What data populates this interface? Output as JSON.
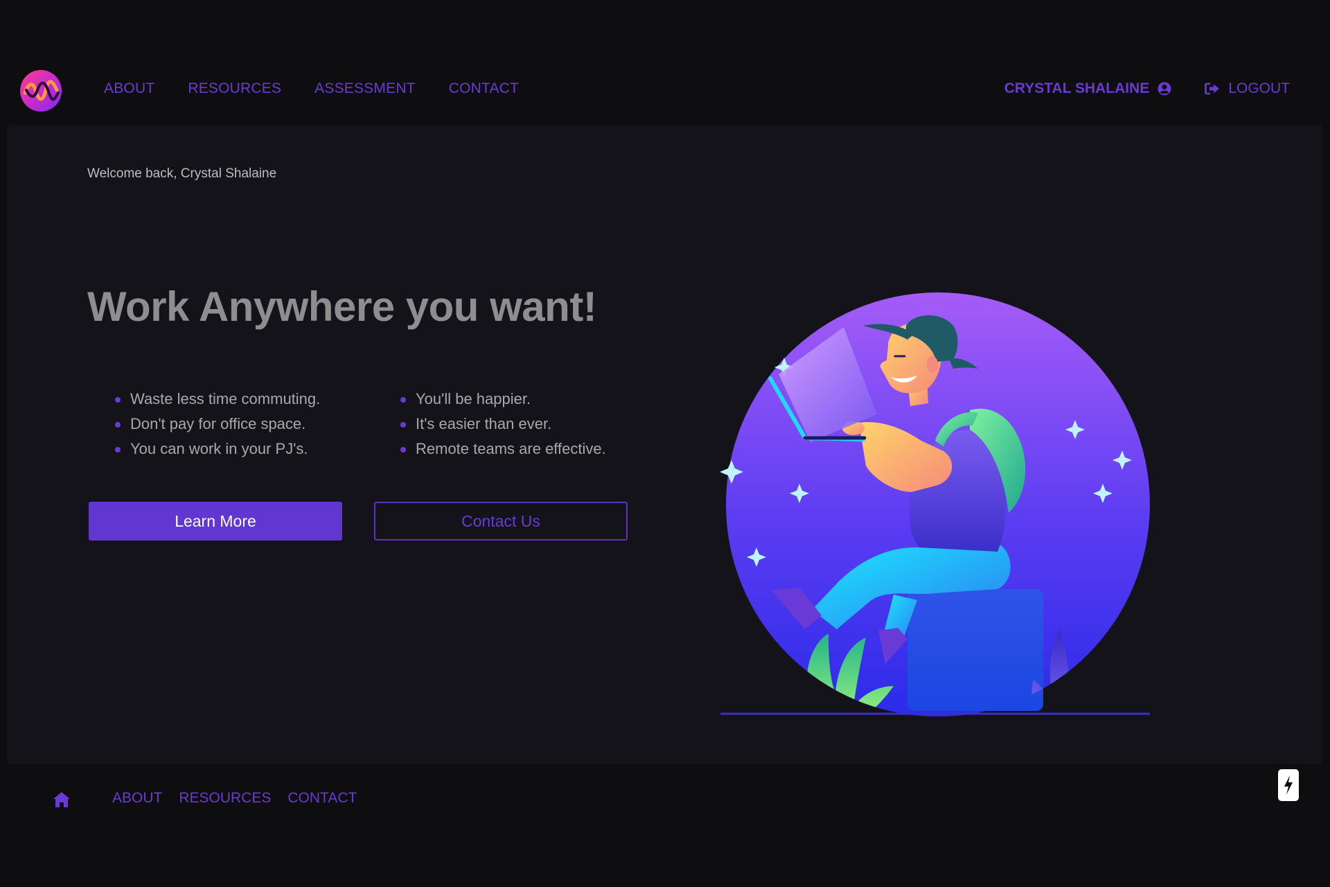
{
  "nav": {
    "links": [
      "ABOUT",
      "RESOURCES",
      "ASSESSMENT",
      "CONTACT"
    ],
    "user_name": "CRYSTAL SHALAINE",
    "logout_label": "LOGOUT"
  },
  "main": {
    "welcome": "Welcome back, Crystal Shalaine",
    "title": "Work Anywhere you want!",
    "bullets_left": [
      "Waste less time commuting.",
      "Don't pay for office space.",
      "You can work in your PJ's."
    ],
    "bullets_right": [
      "You'll be happier.",
      "It's easier than ever.",
      "Remote teams are effective."
    ],
    "primary_button": "Learn More",
    "secondary_button": "Contact Us"
  },
  "footer": {
    "links": [
      "ABOUT",
      "RESOURCES",
      "CONTACT"
    ]
  },
  "icons": {
    "logo": "wave-logo-icon",
    "user": "user-circle-icon",
    "logout": "sign-out-icon",
    "home": "home-icon",
    "badge": "lightning-bolt-icon"
  },
  "colors": {
    "background": "#0e0e10",
    "panel": "#141319",
    "accent": "#6a3ad6",
    "primary_button": "#6236d1"
  }
}
